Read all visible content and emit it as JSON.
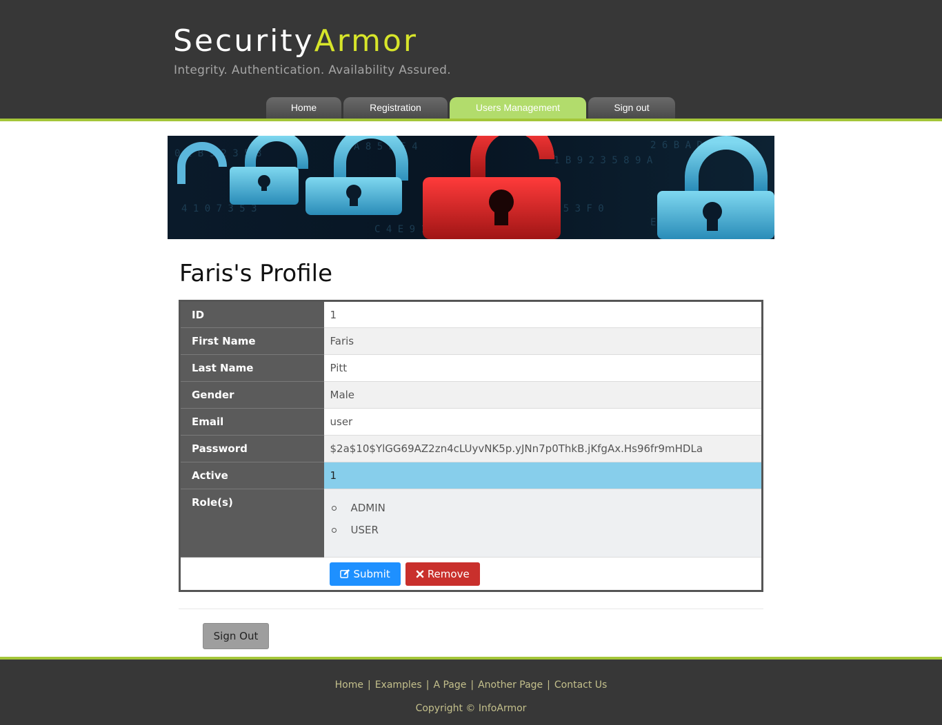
{
  "header": {
    "logo_part1": "Security",
    "logo_part2": "Armor",
    "slogan": "Integrity. Authentication. Availability Assured."
  },
  "menu": {
    "items": [
      {
        "label": "Home"
      },
      {
        "label": "Registration"
      },
      {
        "label": "Users Management",
        "selected": true
      },
      {
        "label": "Sign out"
      }
    ]
  },
  "profile": {
    "title": "Faris's Profile",
    "rows": [
      {
        "key": "ID",
        "value": "1"
      },
      {
        "key": "First Name",
        "value": "Faris"
      },
      {
        "key": "Last Name",
        "value": "Pitt"
      },
      {
        "key": "Gender",
        "value": "Male"
      },
      {
        "key": "Email",
        "value": "user"
      },
      {
        "key": "Password",
        "value": "$2a$10$YlGG69AZ2zn4cLUyvNK5p.yJNn7p0ThkB.jKfgAx.Hs96fr9mHDLa"
      },
      {
        "key": "Active",
        "value": "1"
      },
      {
        "key": "Role(s)",
        "roles": [
          "ADMIN",
          "USER"
        ]
      }
    ],
    "submit_label": "Submit",
    "remove_label": "Remove",
    "sign_out_label": "Sign Out"
  },
  "footer": {
    "links": [
      "Home",
      "Examples",
      "A Page",
      "Another Page",
      "Contact Us"
    ],
    "copyright": "Copyright © InfoArmor"
  },
  "colors": {
    "header_bg": "#373737",
    "accent_green": "#a4c639",
    "logo_yellow": "#d7e52a",
    "menu_selected": "#b2dc6c",
    "active_row": "#87ceeb",
    "submit_blue": "#1e90ff",
    "remove_red": "#c9302c"
  }
}
